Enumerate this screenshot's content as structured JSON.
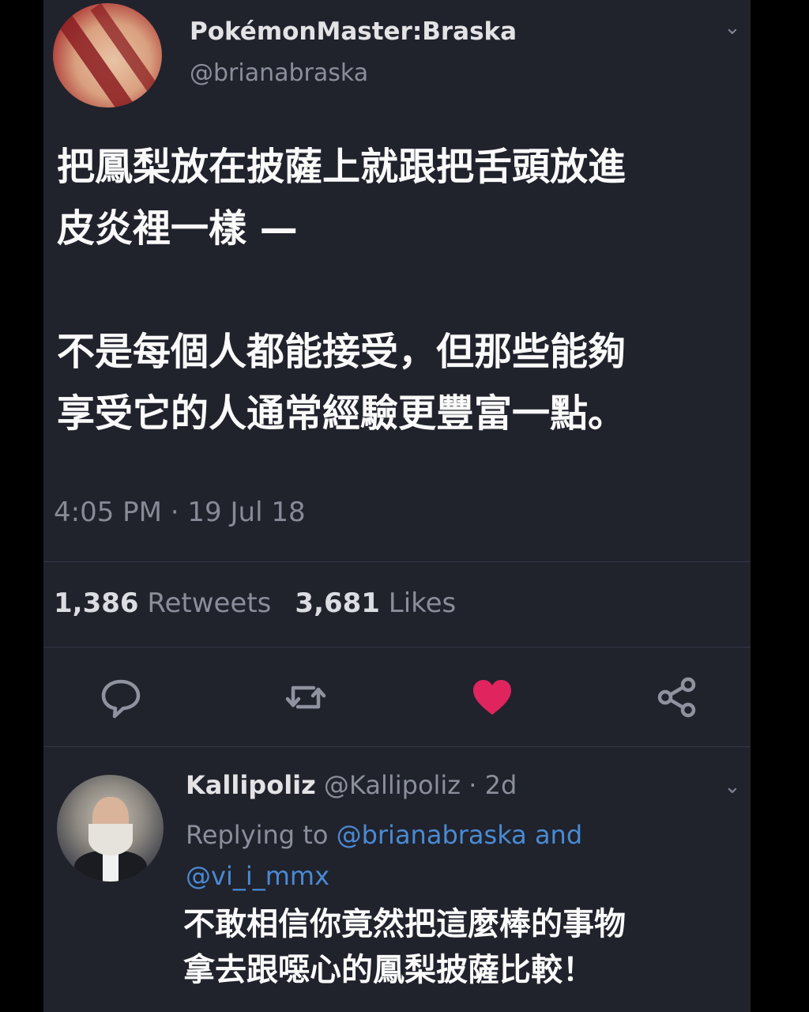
{
  "tweet": {
    "display_name": "PokémonMaster:Braska",
    "handle": "@brianabraska",
    "text_line1": "把鳳梨放在披薩上就跟把舌頭放進",
    "text_line2": "皮炎裡一樣 —",
    "text_line3": "不是每個人都能接受，但那些能夠",
    "text_line4": "享受它的人通常經驗更豐富一點。",
    "timestamp": "4:05 PM · 19 Jul 18",
    "retweets_count": "1,386",
    "retweets_label": "Retweets",
    "likes_count": "3,681",
    "likes_label": "Likes"
  },
  "actions": {
    "reply_icon": "reply-icon",
    "retweet_icon": "retweet-icon",
    "like_icon": "heart-icon",
    "share_icon": "share-icon",
    "like_color": "#e0245e"
  },
  "reply": {
    "display_name": "Kallipoliz",
    "handle_meta": "@Kallipoliz · 2d",
    "replying_to_label": "Replying to",
    "mention1": "@brianabraska",
    "and_label": "and",
    "mention2": "@vi_i_mmx",
    "text_line1": "不敢相信你竟然把這麼棒的事物",
    "text_line2": "拿去跟噁心的鳳梨披薩比較！"
  }
}
